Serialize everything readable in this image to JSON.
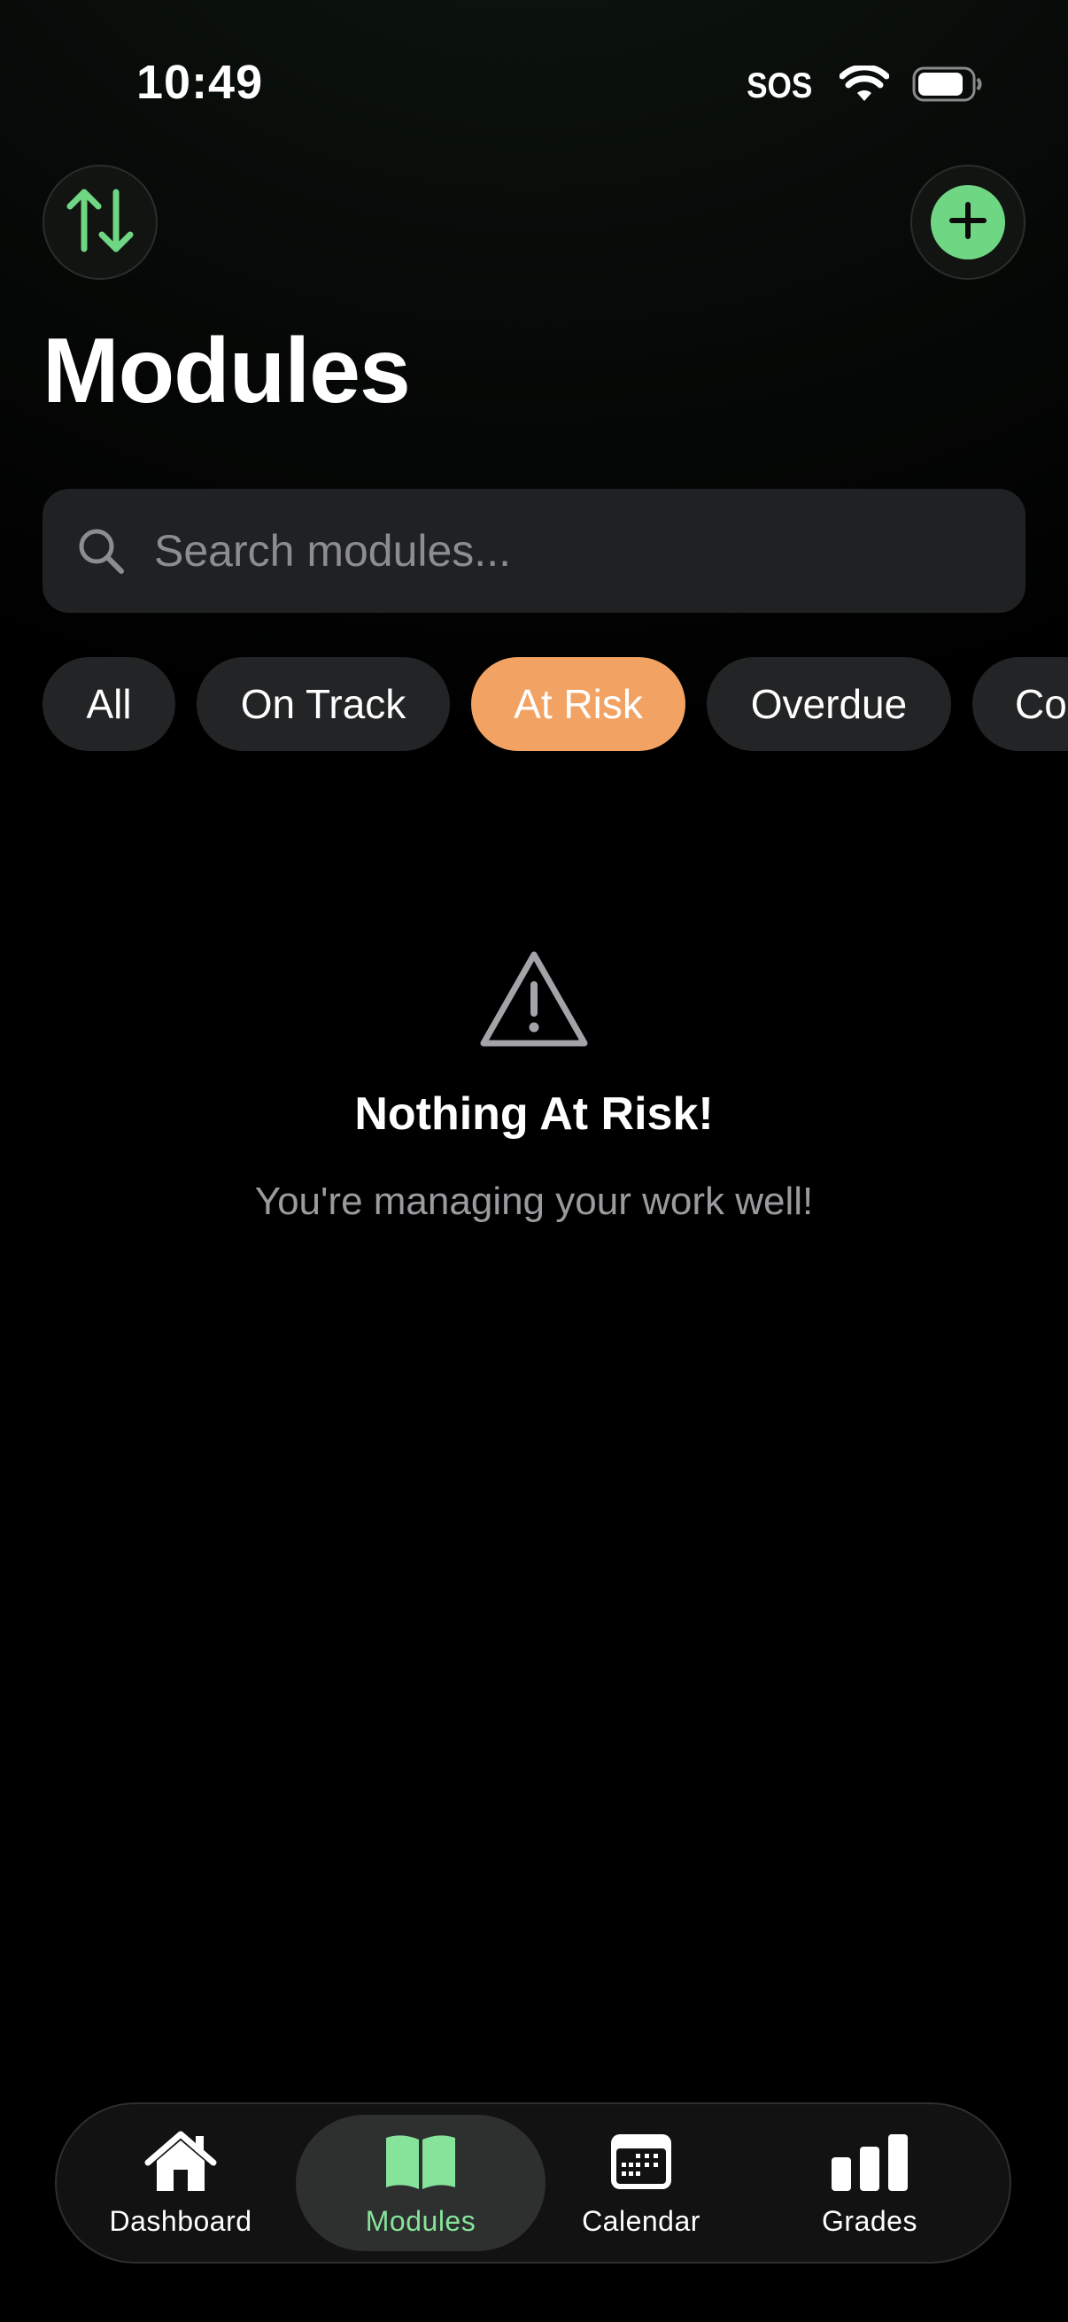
{
  "status_bar": {
    "time": "10:49",
    "carrier": "SOS",
    "icons": [
      "wifi-icon",
      "battery-icon"
    ]
  },
  "header": {
    "sort_icon": "sort-arrows-icon",
    "add_icon": "plus-icon",
    "title": "Modules"
  },
  "search": {
    "placeholder": "Search modules...",
    "value": "",
    "icon": "search-icon"
  },
  "filters": {
    "selected": "At Risk",
    "items": [
      "All",
      "On Track",
      "At Risk",
      "Overdue",
      "Co"
    ]
  },
  "empty_state": {
    "icon": "warning-triangle-icon",
    "title": "Nothing At Risk!",
    "subtitle": "You're managing your work well!"
  },
  "tab_bar": {
    "active": "Modules",
    "items": [
      {
        "label": "Dashboard",
        "icon": "house-icon"
      },
      {
        "label": "Modules",
        "icon": "book-icon"
      },
      {
        "label": "Calendar",
        "icon": "calendar-icon"
      },
      {
        "label": "Grades",
        "icon": "bar-chart-icon"
      }
    ]
  },
  "colors": {
    "accent_green": "#6fd683",
    "active_tab_label": "#86e39a",
    "at_risk_chip": "#f2a263",
    "chip_background": "#232425"
  }
}
